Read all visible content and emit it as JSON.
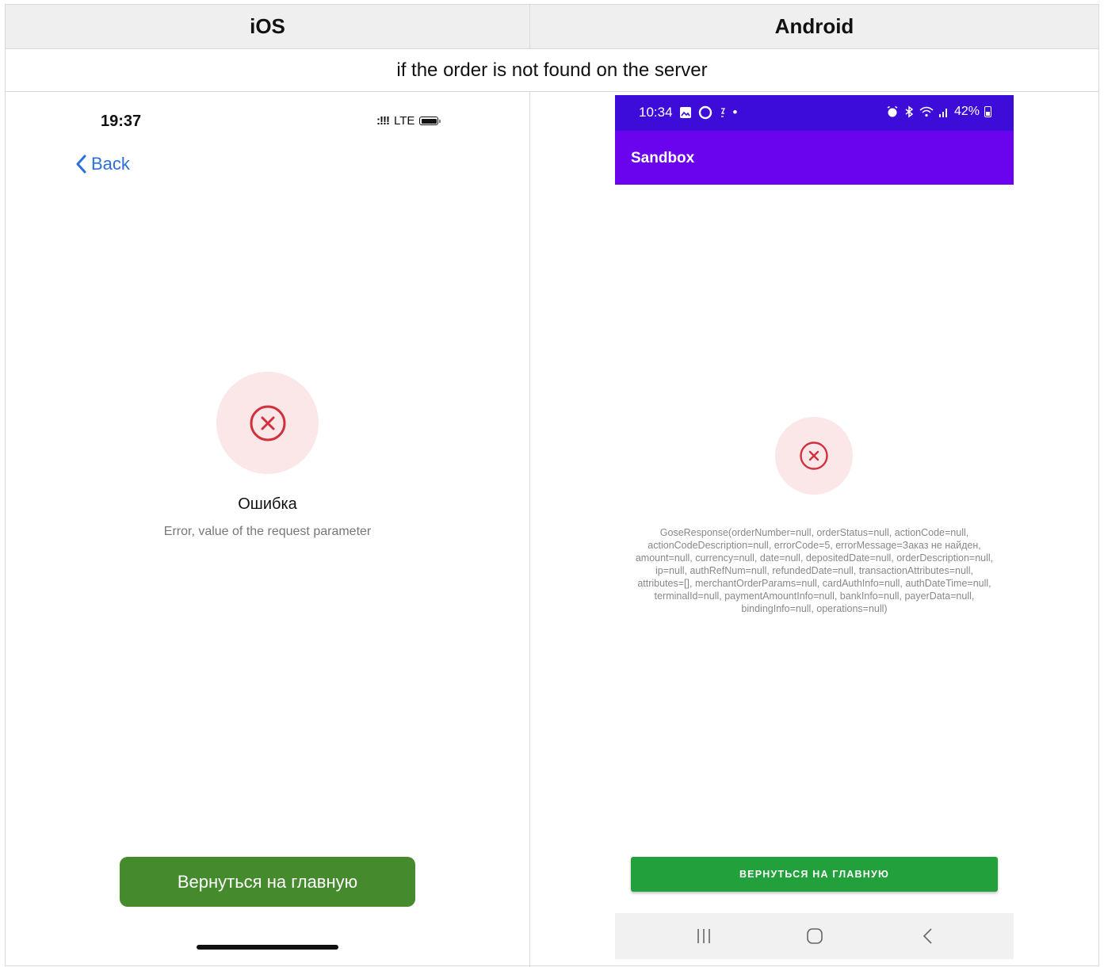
{
  "table": {
    "col_ios": "iOS",
    "col_android": "Android",
    "scenario": "if the order is not found on the server"
  },
  "ios": {
    "time": "19:37",
    "signal": ":!!!",
    "network": "LTE",
    "back_label": "Back",
    "error_title": "Ошибка",
    "error_subtitle": "Error, value of the request parameter",
    "home_button": "Вернуться на главную",
    "colors": {
      "button": "#458a2d",
      "back": "#2c6fd6",
      "error": "#d0313d"
    }
  },
  "android": {
    "time": "10:34",
    "dot": "•",
    "battery": "42%",
    "app_title": "Sandbox",
    "error_message": "GoseResponse(orderNumber=null, orderStatus=null, actionCode=null, actionCodeDescription=null, errorCode=5, errorMessage=Заказ не найден, amount=null, currency=null, date=null, depositedDate=null, orderDescription=null, ip=null, authRefNum=null, refundedDate=null, transactionAttributes=null, attributes=[], merchantOrderParams=null, cardAuthInfo=null, authDateTime=null, terminalId=null, paymentAmountInfo=null, bankInfo=null, payerData=null, bindingInfo=null, operations=null)",
    "home_button": "ВЕРНУТЬСЯ НА ГЛАВНУЮ",
    "nav": {
      "recents": "recents-icon",
      "home": "home-icon",
      "back": "back-icon"
    },
    "colors": {
      "status_bar": "#3d0cd8",
      "app_bar": "#6b04ee",
      "button": "#22a03b"
    }
  }
}
